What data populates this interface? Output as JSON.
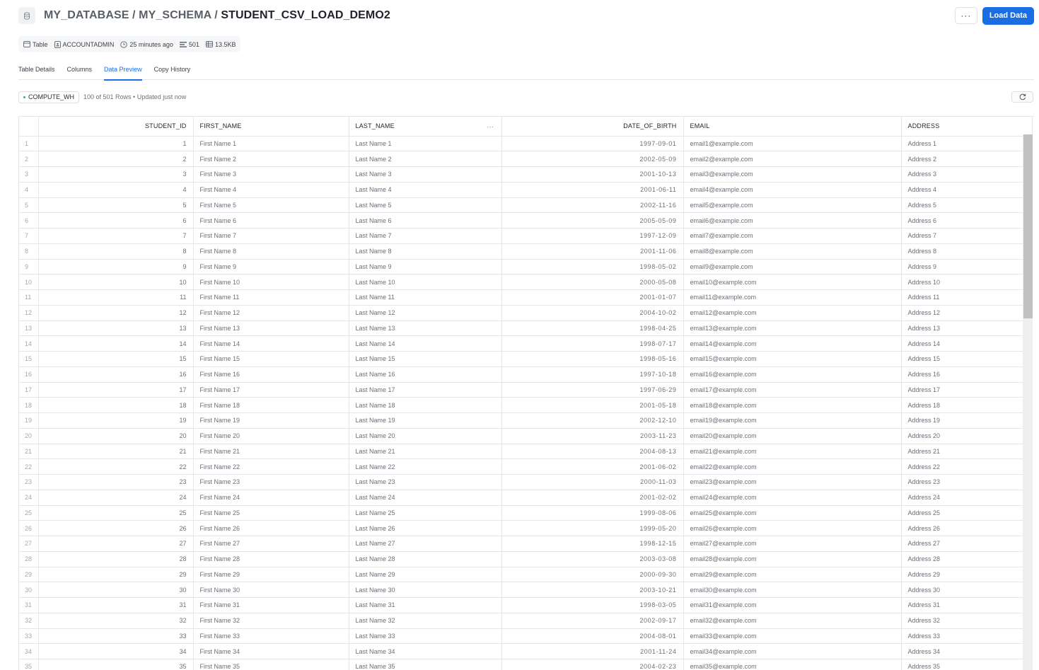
{
  "header": {
    "icon": "database-icon",
    "breadcrumb_prefix": "MY_DATABASE / MY_SCHEMA / ",
    "table_name": "STUDENT_CSV_LOAD_DEMO2",
    "more_label": "···",
    "load_label": "Load Data"
  },
  "meta": {
    "type": "Table",
    "owner": "ACCOUNTADMIN",
    "modified": "25 minutes ago",
    "row_count": "501",
    "size": "13.5KB"
  },
  "tabs": [
    {
      "label": "Table Details",
      "active": false
    },
    {
      "label": "Columns",
      "active": false
    },
    {
      "label": "Data Preview",
      "active": true
    },
    {
      "label": "Copy History",
      "active": false
    }
  ],
  "toolbar": {
    "warehouse": "COMPUTE_WH",
    "rows_info": "100 of 501 Rows • Updated just now"
  },
  "grid": {
    "columns": [
      "STUDENT_ID",
      "FIRST_NAME",
      "LAST_NAME",
      "DATE_OF_BIRTH",
      "EMAIL",
      "ADDRESS"
    ],
    "column_menu": "···",
    "dates": [
      "1997-09-01",
      "2002-05-09",
      "2001-10-13",
      "2001-06-11",
      "2002-11-16",
      "2005-05-09",
      "1997-12-09",
      "2001-11-06",
      "1998-05-02",
      "2000-05-08",
      "2001-01-07",
      "2004-10-02",
      "1998-04-25",
      "1998-07-17",
      "1998-05-16",
      "1997-10-18",
      "1997-06-29",
      "2001-05-18",
      "2002-12-10",
      "2003-11-23",
      "2004-08-13",
      "2001-06-02",
      "2000-11-03",
      "2001-02-02",
      "1999-08-06",
      "1999-05-20",
      "1998-12-15",
      "2003-03-08",
      "2000-09-30",
      "2003-10-21",
      "1998-03-05",
      "2002-09-17",
      "2004-08-01",
      "2001-11-24",
      "2004-02-23"
    ],
    "rows": []
  }
}
